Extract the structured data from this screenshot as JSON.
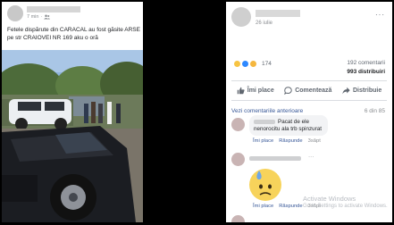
{
  "left_post": {
    "meta": "7 min",
    "caption": "Fetele dispărute din CARACAL au fost găsite ARSE pe str CRAIOVEI NR 169 aku o oră"
  },
  "right_post": {
    "date": "26 iulie",
    "more": "···",
    "reactions_count": "174",
    "comments_count": "192 comentarii",
    "shares_count": "993 distribuiri",
    "actions": {
      "like": "Îmi place",
      "comment": "Comentează",
      "share": "Distribuie"
    },
    "previous_comments": "Vezi comentariile anterioare",
    "comment_counter": "6 din 85",
    "comments": [
      {
        "text": "Pacat de ele nenorocitu ala trb spinzurat",
        "like": "Îmi place",
        "reply": "Răspunde",
        "time": "3săpt"
      },
      {
        "text": "···",
        "like": "Îmi place",
        "reply": "Răspunde",
        "time": "3săpt"
      }
    ],
    "watermark": {
      "line1": "Activate Windows",
      "line2": "Go to Settings to activate Windows."
    }
  },
  "colors": {
    "link": "#385898",
    "muted": "#8a8d91",
    "like_blue": "#2d88ff"
  }
}
